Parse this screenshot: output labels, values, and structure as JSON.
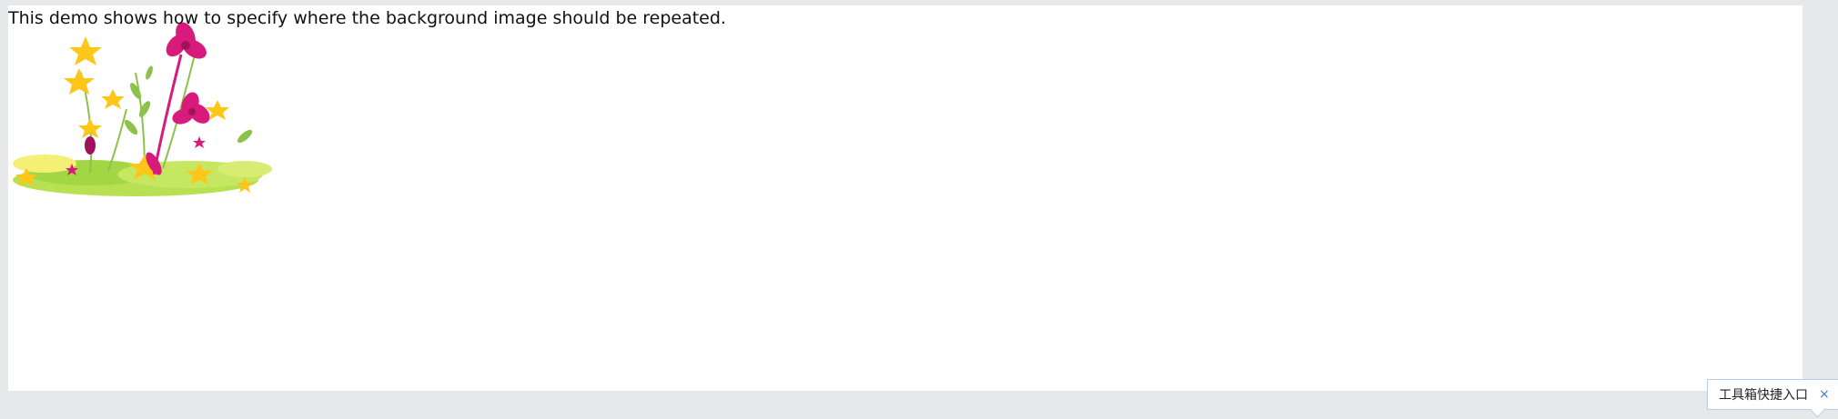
{
  "demo": {
    "text": "This demo shows how to specify where the background image should be repeated.",
    "background_image": "flower-bouquet-illustration"
  },
  "toolbox": {
    "label": "工具箱快捷入口",
    "close_glyph": "×",
    "close_icon": "close-icon"
  },
  "colors": {
    "page_background": "#e7e8ea",
    "frame_background": "#ffffff",
    "text": "#111111",
    "toolbox_border": "#b8cde6",
    "toolbox_close": "#3b7ddd"
  }
}
